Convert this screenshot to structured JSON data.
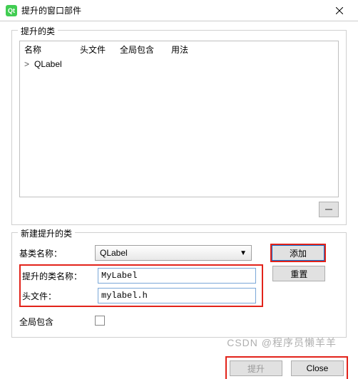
{
  "window": {
    "icon_label": "Qt",
    "title": "提升的窗口部件"
  },
  "promoted": {
    "group_title": "提升的类",
    "columns": [
      "名称",
      "头文件",
      "全局包含",
      "用法"
    ],
    "rows": [
      {
        "expand": ">",
        "name": "QLabel"
      }
    ]
  },
  "new_promoted": {
    "group_title": "新建提升的类",
    "base_label": "基类名称：",
    "base_value": "QLabel",
    "class_label": "提升的类名称：",
    "class_value": "MyLabel",
    "header_label": "头文件：",
    "header_value": "mylabel.h",
    "global_label": "全局包含",
    "global_checked": false,
    "add_label": "添加",
    "reset_label": "重置"
  },
  "bottom": {
    "promote_label": "提升",
    "close_label": "Close"
  },
  "watermark": "CSDN @程序员懒羊羊"
}
